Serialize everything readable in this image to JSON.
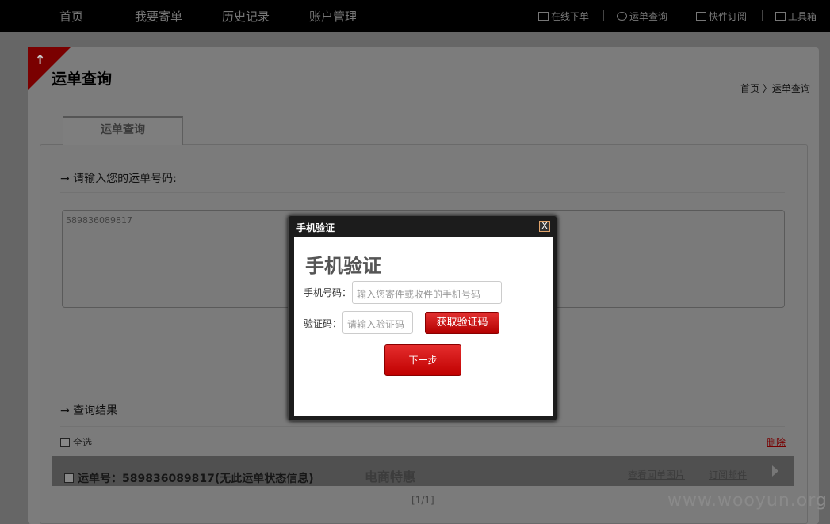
{
  "topnav": {
    "left": [
      "首页",
      "我要寄单",
      "历史记录",
      "账户管理"
    ],
    "right": [
      {
        "icon": "monitor-icon",
        "label": "在线下单"
      },
      {
        "icon": "globe-icon",
        "label": "运单查询"
      },
      {
        "icon": "truck-icon",
        "label": "快件订阅"
      },
      {
        "icon": "toolbox-icon",
        "label": "工具箱"
      }
    ]
  },
  "page": {
    "title": "运单查询",
    "breadcrumb": "首页 〉运单查询",
    "tab": "运单查询",
    "prompt": "→ 请输入您的运单号码:",
    "textarea_value": "589836089817",
    "results_label": "→ 查询结果",
    "select_all": "全选",
    "delete": "删除",
    "result": {
      "waybill": "运单号：589836089817(无此运单状态信息)",
      "promo": "电商特惠",
      "view_image": "查看回单图片",
      "subscribe": "订阅邮件"
    },
    "pager": "[1/1]",
    "watermark": "www.wooyun.org"
  },
  "modal": {
    "title": "手机验证",
    "close": "X",
    "heading": "手机验证",
    "phone_label": "手机号码：",
    "phone_placeholder": "输入您寄件或收件的手机号码",
    "code_label": "验证码：",
    "code_placeholder": "请输入验证码",
    "get_code": "获取验证码",
    "next": "下一步"
  }
}
